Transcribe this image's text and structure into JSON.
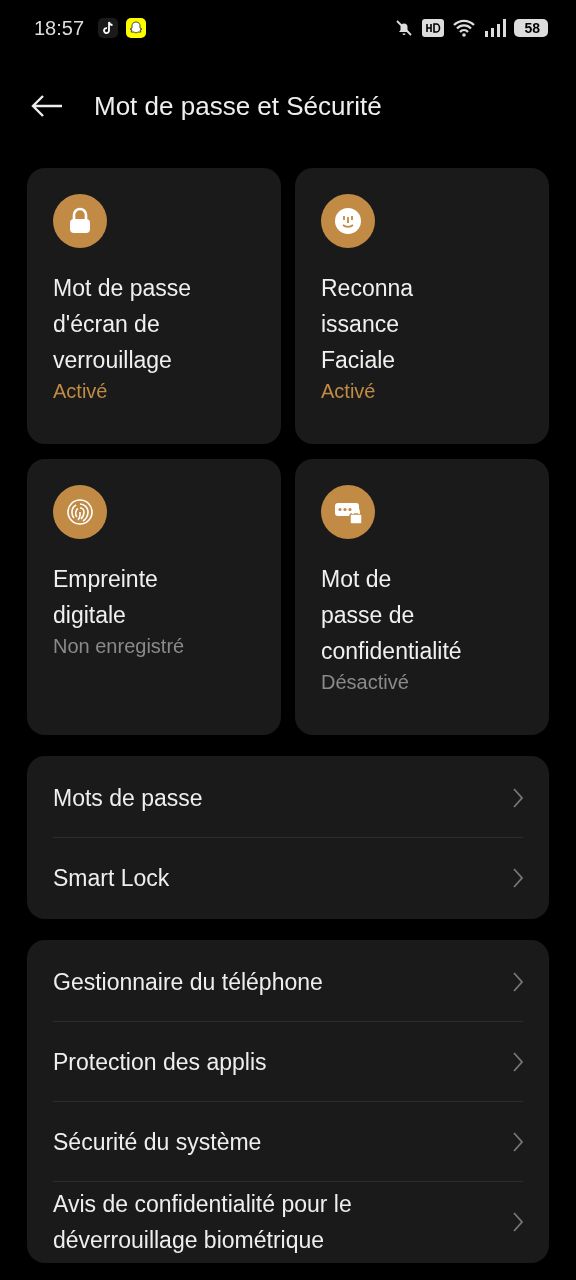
{
  "status_bar": {
    "time": "18:57",
    "battery": "58"
  },
  "header": {
    "title": "Mot de passe et Sécurité"
  },
  "cards": [
    {
      "kind": "lock",
      "title_lines": [
        "Mot de passe",
        "d'écran de",
        "verrouillage"
      ],
      "status": "Activé",
      "active": true
    },
    {
      "kind": "face",
      "title_lines": [
        "Reconna",
        "issance",
        "Faciale"
      ],
      "status": "Activé",
      "active": true
    },
    {
      "kind": "fingerprint",
      "title_lines": [
        "Empreinte",
        "digitale"
      ],
      "status": "Non enregistré",
      "active": false
    },
    {
      "kind": "privacy",
      "title_lines": [
        "Mot de",
        "passe de",
        "confidentialité"
      ],
      "status": "Désactivé",
      "active": false
    }
  ],
  "groups": [
    {
      "items": [
        {
          "label": "Mots de passe"
        },
        {
          "label": "Smart Lock"
        }
      ]
    },
    {
      "items": [
        {
          "label": "Gestionnaire du téléphone"
        },
        {
          "label": "Protection des applis"
        },
        {
          "label": "Sécurité du système"
        },
        {
          "label": "Avis de confidentialité pour le déverrouillage biométrique"
        }
      ]
    }
  ]
}
